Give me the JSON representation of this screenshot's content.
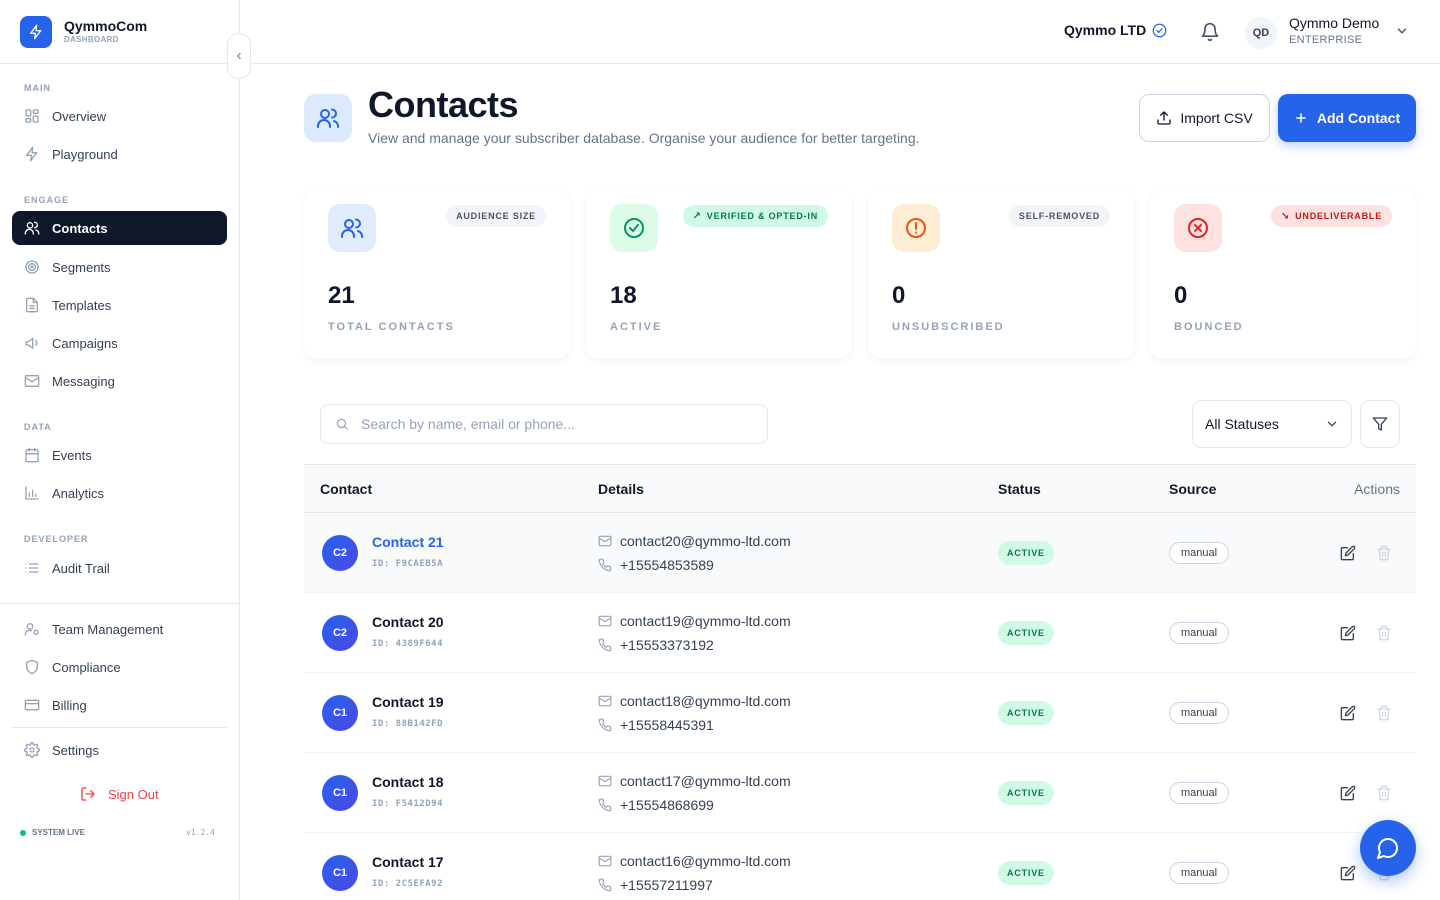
{
  "brand": {
    "name": "QymmoCom",
    "sub": "DASHBOARD"
  },
  "sidebar": {
    "sections": {
      "main": "MAIN",
      "engage": "ENGAGE",
      "data": "DATA",
      "developer": "DEVELOPER"
    },
    "items": {
      "overview": "Overview",
      "playground": "Playground",
      "contacts": "Contacts",
      "segments": "Segments",
      "templates": "Templates",
      "campaigns": "Campaigns",
      "messaging": "Messaging",
      "events": "Events",
      "analytics": "Analytics",
      "audit": "Audit Trail",
      "team": "Team Management",
      "compliance": "Compliance",
      "billing": "Billing",
      "settings": "Settings"
    },
    "signout": "Sign Out",
    "system_status": "SYSTEM LIVE",
    "version": "v1.2.4"
  },
  "header": {
    "org": "Qymmo LTD",
    "user": {
      "initials": "QD",
      "name": "Qymmo Demo",
      "plan": "ENTERPRISE"
    }
  },
  "page": {
    "title": "Contacts",
    "subtitle": "View and manage your subscriber database. Organise your audience for better targeting.",
    "import_label": "Import CSV",
    "add_label": "Add Contact"
  },
  "stats": [
    {
      "badge": "AUDIENCE SIZE",
      "arrow": "",
      "value": "21",
      "label": "TOTAL CONTACTS"
    },
    {
      "badge": "VERIFIED & OPTED-IN",
      "arrow": "↗",
      "value": "18",
      "label": "ACTIVE"
    },
    {
      "badge": "SELF-REMOVED",
      "arrow": "",
      "value": "0",
      "label": "UNSUBSCRIBED"
    },
    {
      "badge": "UNDELIVERABLE",
      "arrow": "↘",
      "value": "0",
      "label": "BOUNCED"
    }
  ],
  "toolbar": {
    "search_placeholder": "Search by name, email or phone...",
    "status_filter": "All Statuses"
  },
  "table": {
    "headers": {
      "contact": "Contact",
      "details": "Details",
      "status": "Status",
      "source": "Source",
      "actions": "Actions"
    },
    "rows": [
      {
        "initials": "C2",
        "name": "Contact 21",
        "id": "ID: F9CAEB5A",
        "email": "contact20@qymmo-ltd.com",
        "phone": "+15554853589",
        "status": "ACTIVE",
        "source": "manual"
      },
      {
        "initials": "C2",
        "name": "Contact 20",
        "id": "ID: 4389F644",
        "email": "contact19@qymmo-ltd.com",
        "phone": "+15553373192",
        "status": "ACTIVE",
        "source": "manual"
      },
      {
        "initials": "C1",
        "name": "Contact 19",
        "id": "ID: 88B142FD",
        "email": "contact18@qymmo-ltd.com",
        "phone": "+15558445391",
        "status": "ACTIVE",
        "source": "manual"
      },
      {
        "initials": "C1",
        "name": "Contact 18",
        "id": "ID: F5412D94",
        "email": "contact17@qymmo-ltd.com",
        "phone": "+15554868699",
        "status": "ACTIVE",
        "source": "manual"
      },
      {
        "initials": "C1",
        "name": "Contact 17",
        "id": "ID: 2C5EFA92",
        "email": "contact16@qymmo-ltd.com",
        "phone": "+15557211997",
        "status": "ACTIVE",
        "source": "manual"
      }
    ]
  },
  "colors": {
    "accent": "#2563eb",
    "sidebar_active": "#0f172a",
    "active_green": "#047857",
    "danger": "#ef4444",
    "warning": "#ea580c"
  }
}
